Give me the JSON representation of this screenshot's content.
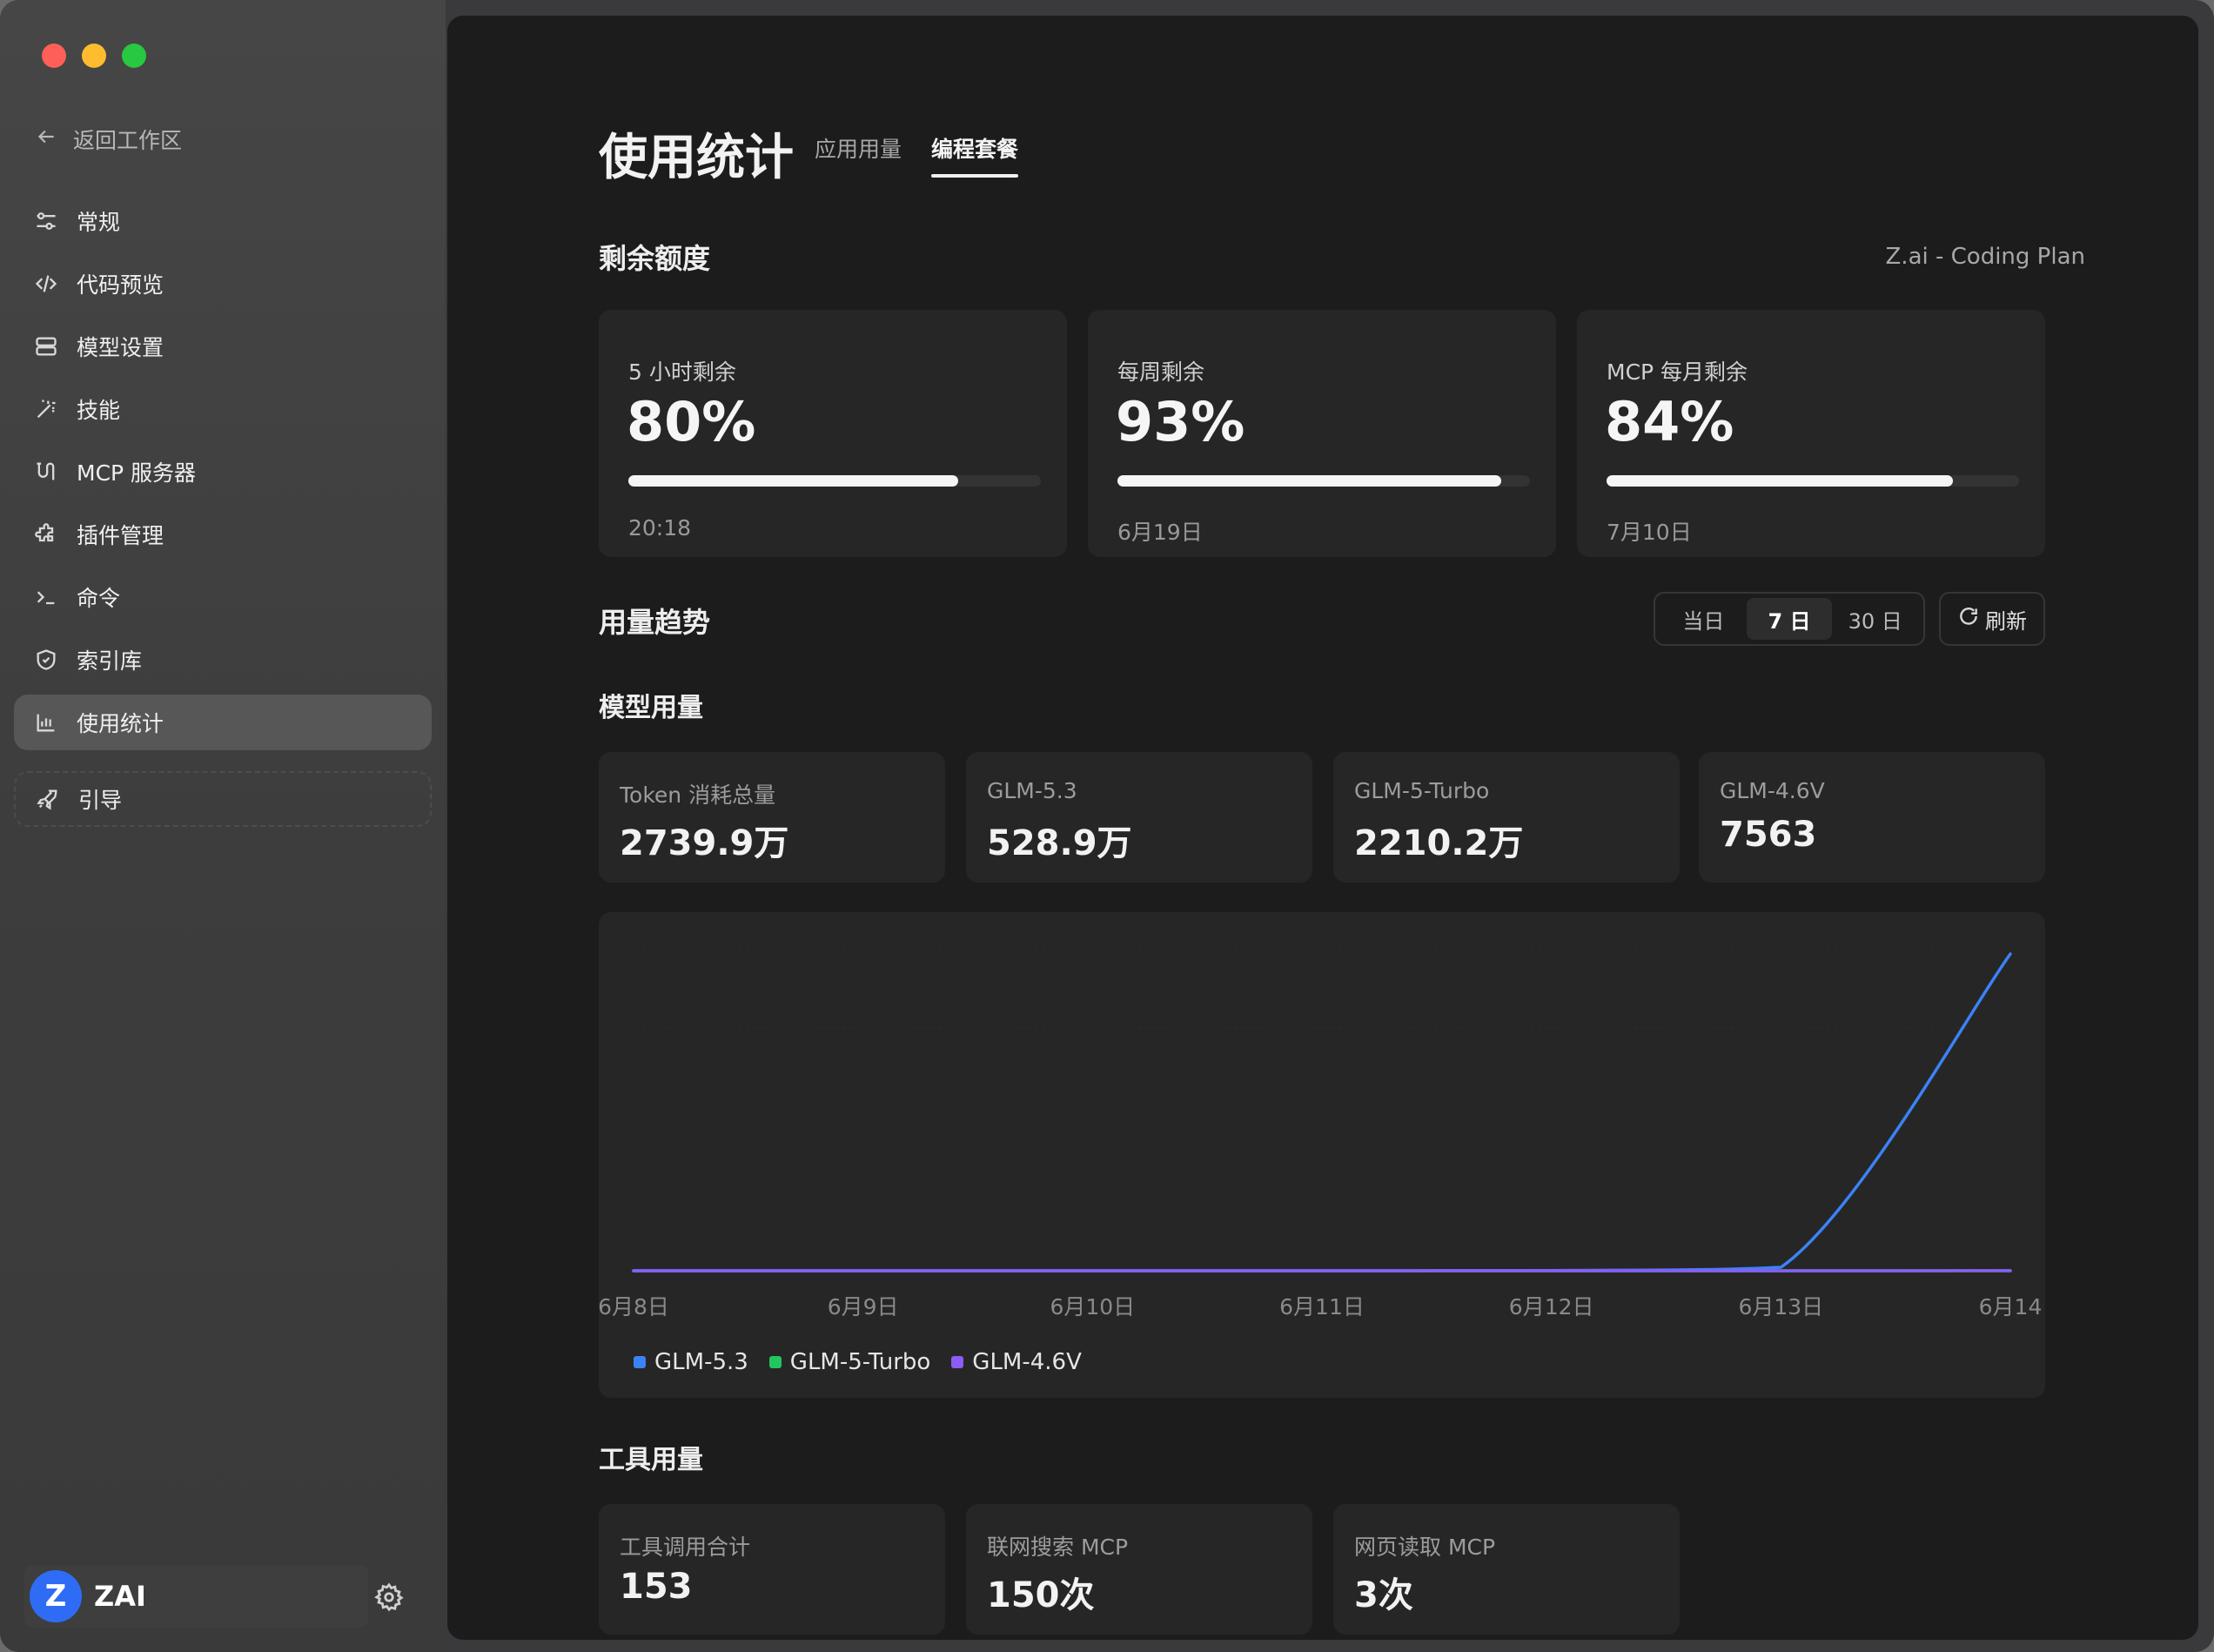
{
  "window": {
    "controls": [
      "close",
      "minimize",
      "zoom"
    ]
  },
  "sidebar": {
    "back_label": "返回工作区",
    "items": [
      {
        "label": "常规",
        "icon": "sliders-icon"
      },
      {
        "label": "代码预览",
        "icon": "code-icon"
      },
      {
        "label": "模型设置",
        "icon": "server-icon"
      },
      {
        "label": "技能",
        "icon": "magic-wand-icon"
      },
      {
        "label": "MCP 服务器",
        "icon": "mcp-icon"
      },
      {
        "label": "插件管理",
        "icon": "puzzle-icon"
      },
      {
        "label": "命令",
        "icon": "terminal-icon"
      },
      {
        "label": "索引库",
        "icon": "shield-icon"
      },
      {
        "label": "使用统计",
        "icon": "bar-chart-icon",
        "active": true
      },
      {
        "label": "引导",
        "icon": "rocket-icon"
      }
    ],
    "user": {
      "avatar_letter": "Z",
      "name": "ZAI",
      "avatar_color": "#2f6cf5"
    }
  },
  "header": {
    "title": "使用统计",
    "tabs": [
      {
        "label": "应用用量",
        "active": false
      },
      {
        "label": "编程套餐",
        "active": true
      }
    ]
  },
  "quota": {
    "title": "剩余额度",
    "plan": "Z.ai - Coding Plan",
    "cards": [
      {
        "label": "5 小时剩余",
        "value": "80%",
        "percent": 80,
        "reset": "20:18"
      },
      {
        "label": "每周剩余",
        "value": "93%",
        "percent": 93,
        "reset": "6月19日"
      },
      {
        "label": "MCP 每月剩余",
        "value": "84%",
        "percent": 84,
        "reset": "7月10日"
      }
    ]
  },
  "trend": {
    "title": "用量趋势",
    "ranges": [
      {
        "label": "当日",
        "active": false
      },
      {
        "label": "7 日",
        "active": true
      },
      {
        "label": "30 日",
        "active": false
      }
    ],
    "refresh_label": "刷新"
  },
  "model_usage": {
    "title": "模型用量",
    "cards": [
      {
        "label": "Token 消耗总量",
        "value": "2739.9万"
      },
      {
        "label": "GLM-5.3",
        "value": "528.9万"
      },
      {
        "label": "GLM-5-Turbo",
        "value": "2210.2万"
      },
      {
        "label": "GLM-4.6V",
        "value": "7563"
      }
    ]
  },
  "chart_data": {
    "type": "line",
    "x": [
      "6月8日",
      "6月9日",
      "6月10日",
      "6月11日",
      "6月12日",
      "6月13日",
      "6月14"
    ],
    "series": [
      {
        "name": "GLM-5.3",
        "color": "#3b82f6",
        "values": [
          0,
          0,
          0,
          0,
          2,
          30,
          2739.9
        ]
      },
      {
        "name": "GLM-5-Turbo",
        "color": "#22c55e",
        "values": [
          0,
          0,
          0,
          0,
          0,
          0,
          0
        ]
      },
      {
        "name": "GLM-4.6V",
        "color": "#8b5cf6",
        "values": [
          0,
          0,
          0,
          0,
          0,
          0,
          0.8
        ]
      }
    ],
    "ylim": [
      0,
      2800
    ],
    "grid": true,
    "legend": "bottom-left"
  },
  "tool_usage": {
    "title": "工具用量",
    "cards": [
      {
        "label": "工具调用合计",
        "value": "153"
      },
      {
        "label": "联网搜索 MCP",
        "value": "150次"
      },
      {
        "label": "网页读取 MCP",
        "value": "3次"
      }
    ]
  }
}
